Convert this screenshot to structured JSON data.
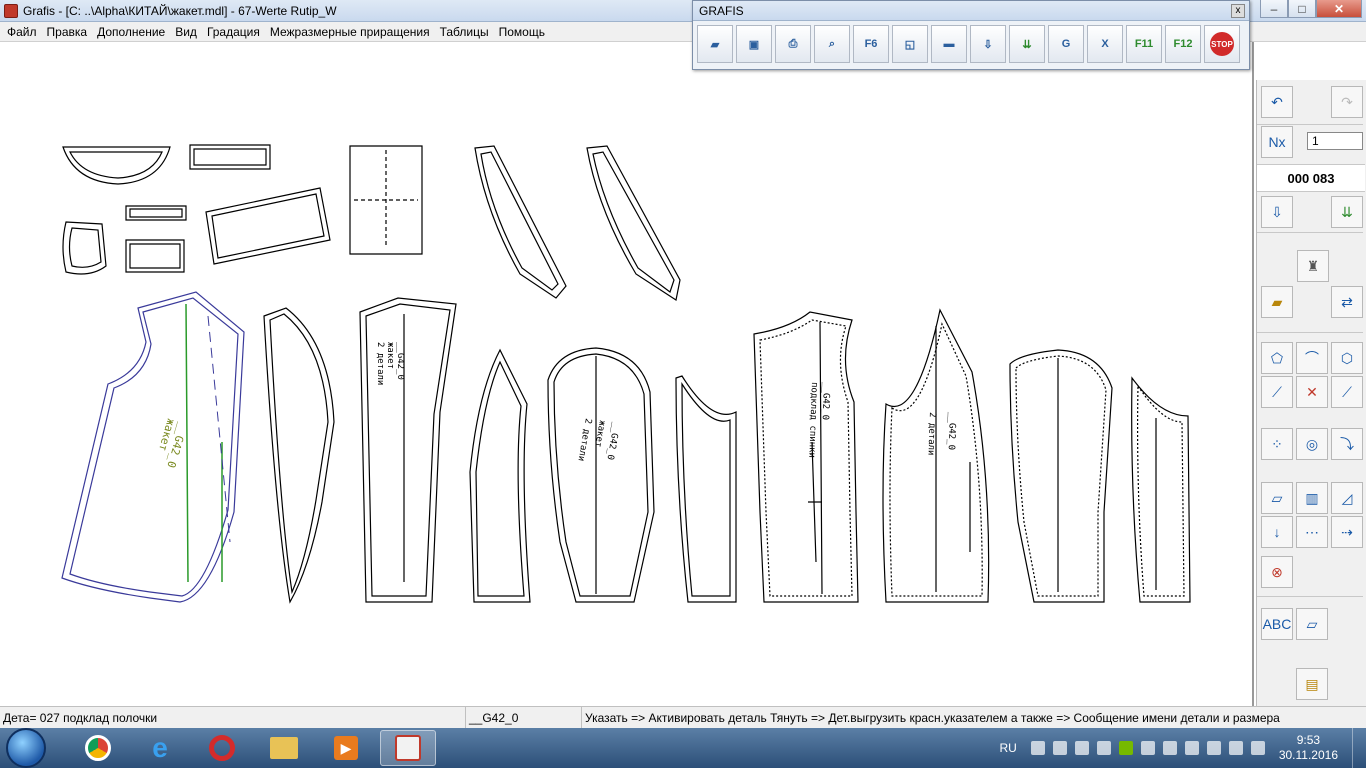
{
  "window": {
    "title": "Grafis - [C: ..\\Alpha\\КИТАЙ\\жакет.mdl] - 67-Werte Rutip_W",
    "minimize": "–",
    "maximize": "□",
    "close": "✕"
  },
  "menu": [
    "Файл",
    "Правка",
    "Дополнение",
    "Вид",
    "Градация",
    "Межразмерные приращения",
    "Таблицы",
    "Помощь"
  ],
  "toolbox": {
    "title": "GRAFIS",
    "close": "x",
    "buttons": [
      "open-folder",
      "save",
      "print",
      "zoom",
      "F6",
      "layers",
      "measure",
      "download",
      "download-green",
      "G",
      "X",
      "F11",
      "F12",
      "STOP"
    ]
  },
  "right_panel": {
    "counter_value": "1",
    "code": "000 083"
  },
  "pattern_labels": {
    "label1": "__G42_0",
    "label2": "жакет",
    "label3": "2 детали",
    "label4": "подклад спинки"
  },
  "status": {
    "detail": "Дета= 027  подклад полочки",
    "size": "__G42_0",
    "hint": "Указать => Активировать деталь Тянуть => Дет.выгрузить красн.указателем а также => Сообщение имени детали и размера"
  },
  "taskbar": {
    "lang": "RU",
    "time": "9:53",
    "date": "30.11.2016"
  }
}
